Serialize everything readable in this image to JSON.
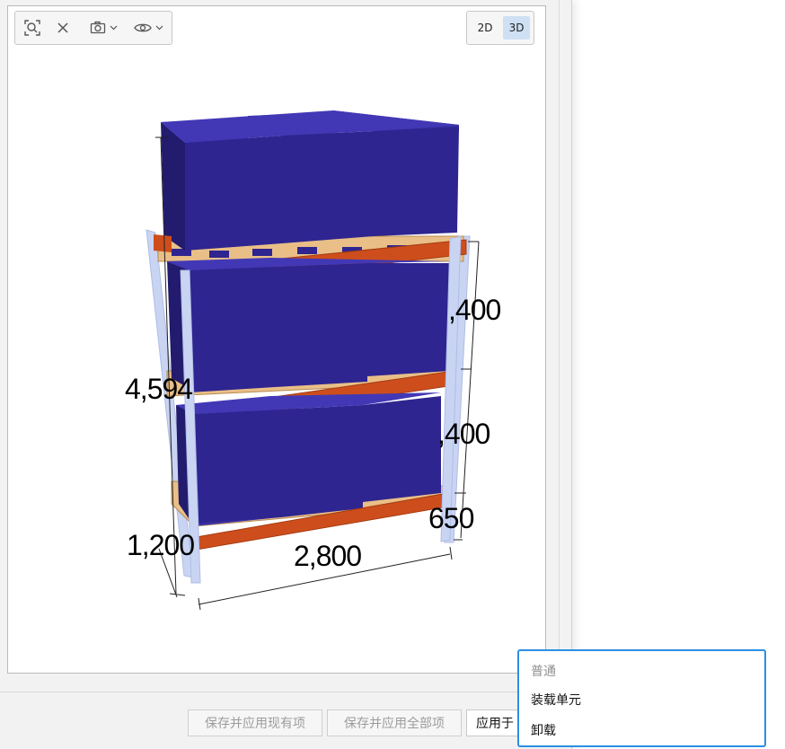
{
  "toolbar": {
    "zoom_fit_icon": "zoom-fit-icon",
    "close_icon": "close-icon",
    "camera_icon": "camera-icon",
    "visibility_icon": "eye-icon"
  },
  "view_toggle": {
    "option_2d": "2D",
    "option_3d": "3D",
    "selected": "3D"
  },
  "dimensions": {
    "total_height": "4,594",
    "level_top": ",400",
    "level_middle": ",400",
    "bottom_clearance": "650",
    "depth": "1,200",
    "width": "2,800"
  },
  "colors": {
    "load_unit": "#2e2590",
    "beam": "#cd4e1c",
    "pallet": "#e9bf87",
    "upright": "#c9d4f3",
    "menu_border": "#2b8fe6"
  },
  "buttons": {
    "save_apply_current": "保存并应用现有项",
    "save_apply_all": "保存并应用全部项",
    "apply_to": "应用于"
  },
  "menu": {
    "items": [
      {
        "label": "普通",
        "disabled": true
      },
      {
        "label": "装载单元",
        "disabled": false
      },
      {
        "label": "卸载",
        "disabled": false
      }
    ]
  }
}
